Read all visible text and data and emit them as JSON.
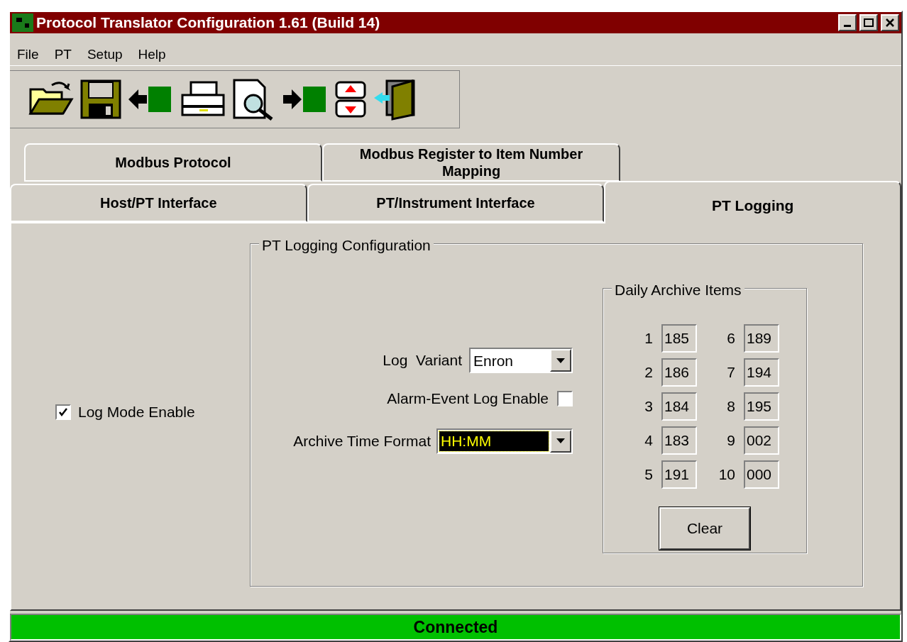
{
  "window": {
    "title": "Protocol Translator Configuration 1.61 (Build 14)"
  },
  "menu": [
    "File",
    "PT",
    "Setup",
    "Help"
  ],
  "toolbar": [
    {
      "kind": "open"
    },
    {
      "kind": "save"
    },
    {
      "kind": "upload"
    },
    {
      "kind": "print"
    },
    {
      "kind": "preview"
    },
    {
      "kind": "download"
    },
    {
      "kind": "sync"
    },
    {
      "kind": "exit"
    }
  ],
  "tab_rows": [
    [
      {
        "label": "Modbus Protocol",
        "selected": false
      },
      {
        "label": "Modbus Register to Item Number Mapping",
        "selected": false
      }
    ],
    [
      {
        "label": "Host/PT Interface",
        "selected": false
      },
      {
        "label": "PT/Instrument Interface",
        "selected": false
      },
      {
        "label": "PT Logging",
        "selected": true
      }
    ]
  ],
  "log_mode_enable": {
    "label": "Log Mode Enable",
    "checked": true
  },
  "group": {
    "title": "PT Logging Configuration",
    "log_variant": {
      "label": "Log  Variant",
      "value": "Enron",
      "focused": false
    },
    "alarm_event": {
      "label": "Alarm-Event Log Enable",
      "checked": false
    },
    "archive_time_format": {
      "label": "Archive Time Format",
      "value": "HH:MM",
      "focused": true
    },
    "daily_archive": {
      "title": "Daily Archive Items",
      "items": [
        {
          "index": "1",
          "value": "185"
        },
        {
          "index": "2",
          "value": "186"
        },
        {
          "index": "3",
          "value": "184"
        },
        {
          "index": "4",
          "value": "183"
        },
        {
          "index": "5",
          "value": "191"
        },
        {
          "index": "6",
          "value": "189"
        },
        {
          "index": "7",
          "value": "194"
        },
        {
          "index": "8",
          "value": "195"
        },
        {
          "index": "9",
          "value": "002"
        },
        {
          "index": "10",
          "value": "000"
        }
      ],
      "button": "Clear"
    }
  },
  "status_bar": {
    "text": "Connected"
  }
}
